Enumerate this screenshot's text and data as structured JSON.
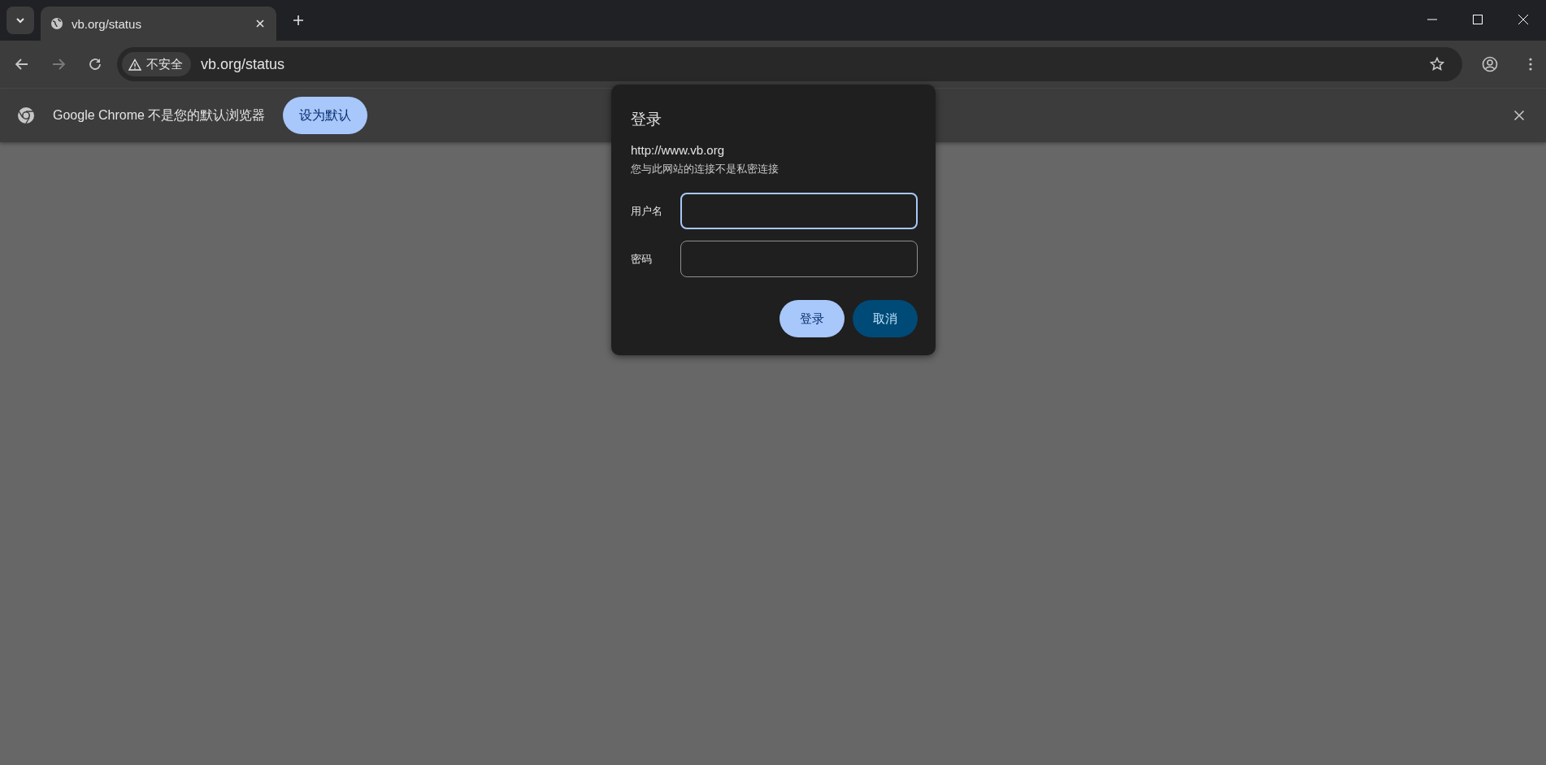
{
  "tab_strip": {
    "tabs": [
      {
        "title": "vb.org/status",
        "selected": true
      }
    ]
  },
  "toolbar": {
    "security_chip": "不安全",
    "url": "vb.org/status"
  },
  "infobar": {
    "message": "Google Chrome 不是您的默认浏览器",
    "button": "设为默认"
  },
  "dialog": {
    "title": "登录",
    "origin": "http://www.vb.org",
    "note": "您与此网站的连接不是私密连接",
    "fields": [
      {
        "label": "用户名",
        "focused": true
      },
      {
        "label": "密码",
        "focused": false
      }
    ],
    "buttons": [
      {
        "label": "登录",
        "kind": "primary"
      },
      {
        "label": "取消",
        "kind": "secondary"
      }
    ]
  }
}
